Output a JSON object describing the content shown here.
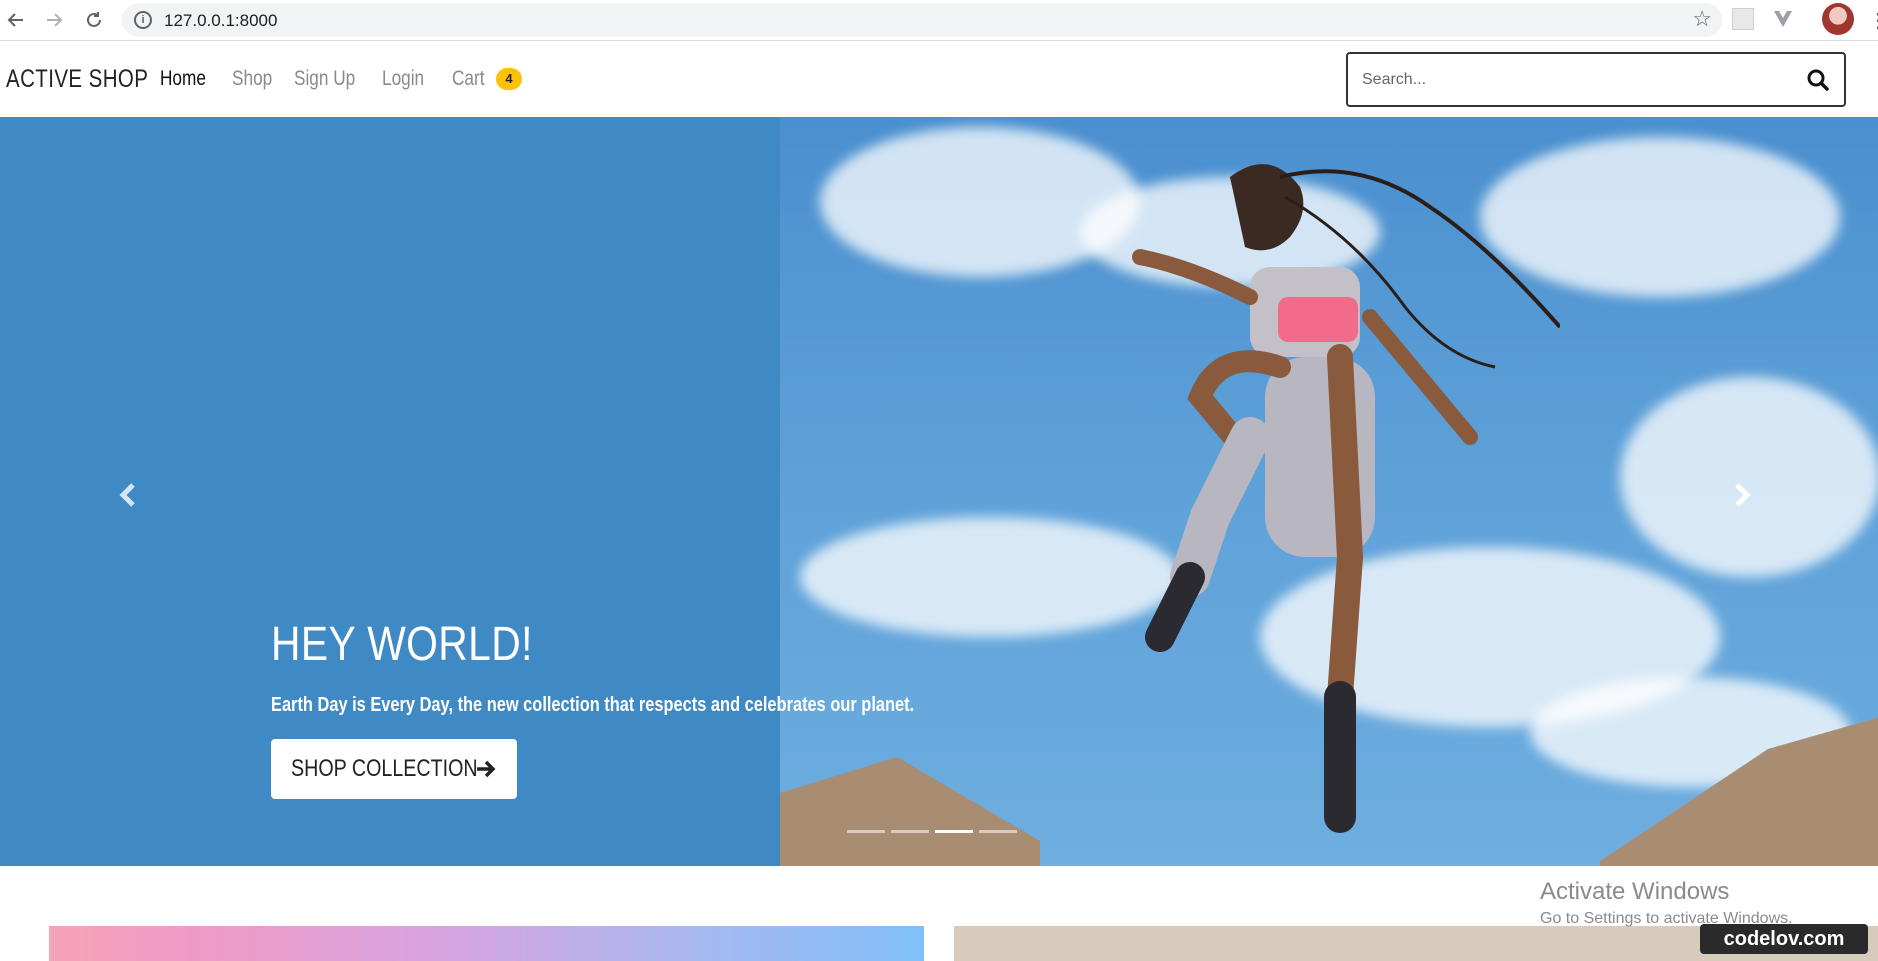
{
  "browser": {
    "url": "127.0.0.1:8000",
    "info_icon": "info-icon",
    "star_icon": "star-icon"
  },
  "site": {
    "brand": "ACTIVE SHOP",
    "nav": {
      "home": "Home",
      "shop": "Shop",
      "signup": "Sign Up",
      "login": "Login",
      "cart": "Cart",
      "cart_count": "4"
    },
    "search": {
      "placeholder": "Search..."
    }
  },
  "hero": {
    "title": "HEY WORLD!",
    "subtitle": "Earth Day is Every Day, the new collection that respects and celebrates our planet.",
    "button_label": "SHOP COLLECTION",
    "slide_count": 4,
    "active_slide": 3
  },
  "overlays": {
    "activate_title": "Activate Windows",
    "activate_sub": "Go to Settings to activate Windows.",
    "watermark": "codelov.com"
  },
  "colors": {
    "hero_blue": "#3f89c4",
    "cart_badge": "#ffc107"
  }
}
